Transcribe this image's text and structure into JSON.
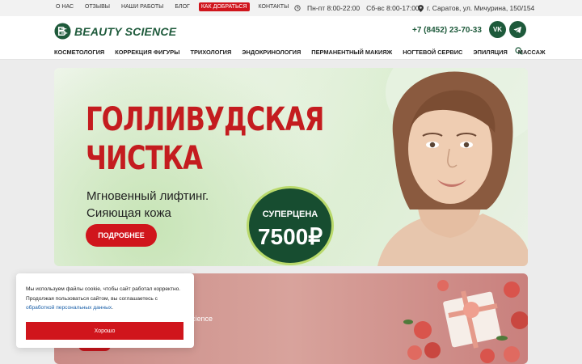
{
  "topbar": {
    "links": [
      "О НАС",
      "ОТЗЫВЫ",
      "НАШИ РАБОТЫ",
      "БЛОГ",
      "КАК ДОБРАТЬСЯ",
      "КОНТАКТЫ"
    ],
    "hours_weekdays": "Пн-пт 8:00-22:00",
    "hours_weekend": "Сб-вс 8:00-17:00",
    "address": "г. Саратов, ул. Мичурина, 150/154"
  },
  "header": {
    "logo_text": "BEAUTY SCIENCE",
    "phone": "+7 (8452) 23-70-33",
    "social": [
      {
        "name": "vk-icon",
        "label": "VK"
      },
      {
        "name": "telegram-icon",
        "label": ""
      }
    ]
  },
  "nav": {
    "items": [
      "КОСМЕТОЛОГИЯ",
      "КОРРЕКЦИЯ ФИГУРЫ",
      "ТРИХОЛОГИЯ",
      "ЭНДОКРИНОЛОГИЯ",
      "ПЕРМАНЕНТНЫЙ МАКИЯЖ",
      "НОГТЕВОЙ СЕРВИС",
      "ЭПИЛЯЦИЯ",
      "МАССАЖ"
    ]
  },
  "hero": {
    "title_line1": "ГОЛЛИВУДСКАЯ",
    "title_line2": "ЧИСТКА",
    "subtitle_line1": "Мгновенный лифтинг.",
    "subtitle_line2": "Сияющая кожа",
    "button": "ПОДРОБНЕЕ",
    "price_label": "СУПЕРЦЕНА",
    "price_value": "7500₽"
  },
  "banner2": {
    "partial_text": "cience"
  },
  "cookie": {
    "line1": "Мы используем файлы cookie, чтобы сайт работал корректно.",
    "line2": "Продолжая пользоваться сайтом, вы соглашаетесь с",
    "link": "обработкой персональных данных",
    "link_suffix": ".",
    "button": "Хорошо"
  },
  "colors": {
    "brand_green": "#1e5a3b",
    "accent_red": "#d0151c",
    "price_circle": "#174d30"
  }
}
